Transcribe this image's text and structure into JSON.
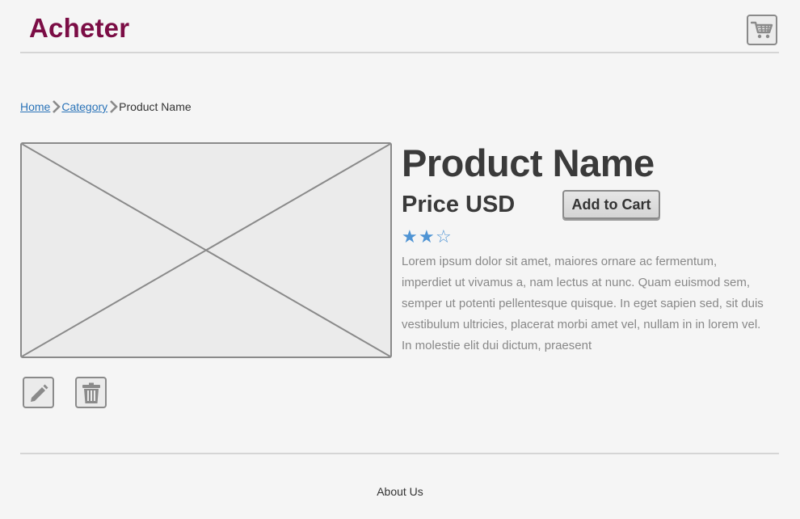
{
  "header": {
    "brand": "Acheter",
    "cart_icon": "shopping-cart-icon"
  },
  "breadcrumb": {
    "items": [
      {
        "label": "Home",
        "link": true
      },
      {
        "label": "Category",
        "link": true
      },
      {
        "label": "Product Name",
        "link": false
      }
    ],
    "separator_icon": "chevron-right-icon"
  },
  "product": {
    "image_icon": "image-placeholder-icon",
    "name": "Product Name",
    "price": "Price USD",
    "add_to_cart_label": "Add to Cart",
    "rating": {
      "value": 2,
      "max": 3,
      "filled_glyph": "★",
      "empty_glyph": "☆"
    },
    "description": "Lorem ipsum dolor sit amet, maiores ornare ac fermentum, imperdiet ut vivamus a, nam lectus at nunc. Quam euismod sem, semper ut potenti pellentesque quisque. In eget sapien sed, sit duis vestibulum ultricies, placerat morbi amet vel, nullam in in lorem vel. In molestie elit dui dictum, praesent"
  },
  "actions": {
    "edit_icon": "pencil-icon",
    "delete_icon": "trash-icon"
  },
  "footer": {
    "about_label": "About Us"
  },
  "colors": {
    "brand": "#7b0d45",
    "link": "#2a73b8",
    "star": "#4f94d4",
    "border": "#8a8a8a",
    "background": "#f5f5f5"
  }
}
